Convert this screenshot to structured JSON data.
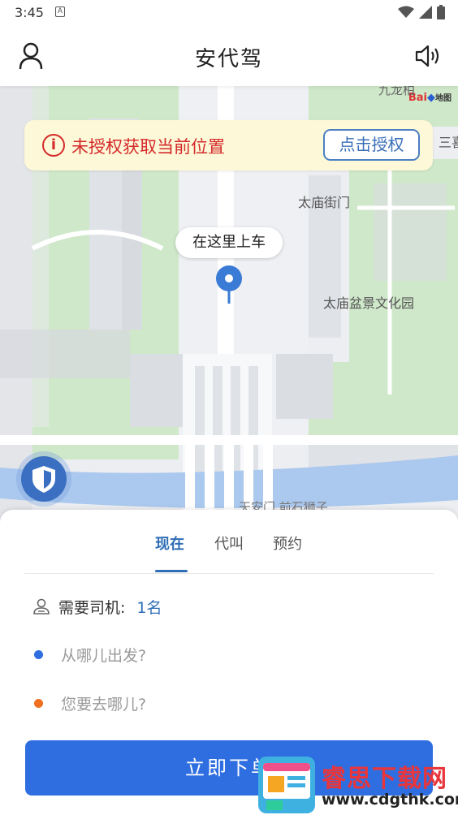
{
  "status_bar": {
    "time": "3:45",
    "notification_icon": "a-letter-icon",
    "icons": [
      "wifi-icon",
      "signal-icon",
      "battery-icon"
    ]
  },
  "header": {
    "title": "安代驾",
    "left_icon": "user-icon",
    "right_icon": "speaker-icon"
  },
  "map": {
    "labels": {
      "top_partial": "九龙柏",
      "street_gate": "太庙街门",
      "garden": "太庙盆景文化园",
      "right_partial": "三喜",
      "bottom_partial": "天安门 前石狮子"
    },
    "logo_text": "Bai",
    "logo_text2": "地图",
    "pickup_label": "在这里上车"
  },
  "auth_banner": {
    "message": "未授权获取当前位置",
    "button_label": "点击授权"
  },
  "tabs": [
    {
      "label": "现在",
      "active": true
    },
    {
      "label": "代叫",
      "active": false
    },
    {
      "label": "预约",
      "active": false
    }
  ],
  "form": {
    "driver_label": "需要司机:",
    "driver_value": "1名",
    "from_placeholder": "从哪儿出发?",
    "to_placeholder": "您要去哪儿?"
  },
  "cta_label": "立即下单",
  "colors": {
    "accent": "#2f6db5",
    "button": "#2f6ee0",
    "alert": "#d52a2a",
    "from_dot": "#2f6ee0",
    "to_dot": "#f07020"
  },
  "watermark": {
    "title": "睿思下载网",
    "url": "www.cdgthk.com"
  }
}
